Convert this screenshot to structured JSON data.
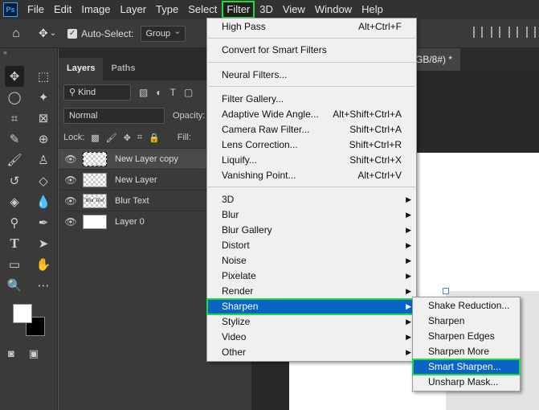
{
  "menubar": {
    "logo": "Ps",
    "items": [
      "File",
      "Edit",
      "Image",
      "Layer",
      "Type",
      "Select",
      "Filter",
      "3D",
      "View",
      "Window",
      "Help"
    ]
  },
  "options": {
    "auto_select_label": "Auto-Select:",
    "auto_select_value": "Group"
  },
  "layers_panel": {
    "tabs": [
      "Layers",
      "Paths"
    ],
    "kind_label": "Kind",
    "blend_mode": "Normal",
    "opacity_label": "Opacity:",
    "lock_label": "Lock:",
    "fill_label": "Fill:",
    "layers": [
      {
        "name": "New Layer copy",
        "selected": true,
        "thumb_text": ""
      },
      {
        "name": "New Layer",
        "selected": false,
        "thumb_text": ""
      },
      {
        "name": "Blur Text",
        "selected": false,
        "thumb_text": "Blur Text"
      },
      {
        "name": "Layer 0",
        "selected": false,
        "thumb_text": ""
      }
    ]
  },
  "document": {
    "tab_label": "GB/8#) *"
  },
  "filter_menu": {
    "items": [
      {
        "label": "High Pass",
        "shortcut": "Alt+Ctrl+F"
      },
      {
        "label": "Convert for Smart Filters",
        "shortcut": ""
      },
      {
        "label": "Neural Filters...",
        "shortcut": ""
      },
      {
        "label": "Filter Gallery...",
        "shortcut": ""
      },
      {
        "label": "Adaptive Wide Angle...",
        "shortcut": "Alt+Shift+Ctrl+A"
      },
      {
        "label": "Camera Raw Filter...",
        "shortcut": "Shift+Ctrl+A"
      },
      {
        "label": "Lens Correction...",
        "shortcut": "Shift+Ctrl+R"
      },
      {
        "label": "Liquify...",
        "shortcut": "Shift+Ctrl+X"
      },
      {
        "label": "Vanishing Point...",
        "shortcut": "Alt+Ctrl+V"
      },
      {
        "label": "3D"
      },
      {
        "label": "Blur"
      },
      {
        "label": "Blur Gallery"
      },
      {
        "label": "Distort"
      },
      {
        "label": "Noise"
      },
      {
        "label": "Pixelate"
      },
      {
        "label": "Render"
      },
      {
        "label": "Sharpen"
      },
      {
        "label": "Stylize"
      },
      {
        "label": "Video"
      },
      {
        "label": "Other"
      }
    ]
  },
  "sharpen_submenu": {
    "items": [
      "Shake Reduction...",
      "Sharpen",
      "Sharpen Edges",
      "Sharpen More",
      "Smart Sharpen...",
      "Unsharp Mask..."
    ]
  },
  "colors": {
    "highlight": "#0a64c8",
    "annotation_outline": "#1fdc3c"
  }
}
